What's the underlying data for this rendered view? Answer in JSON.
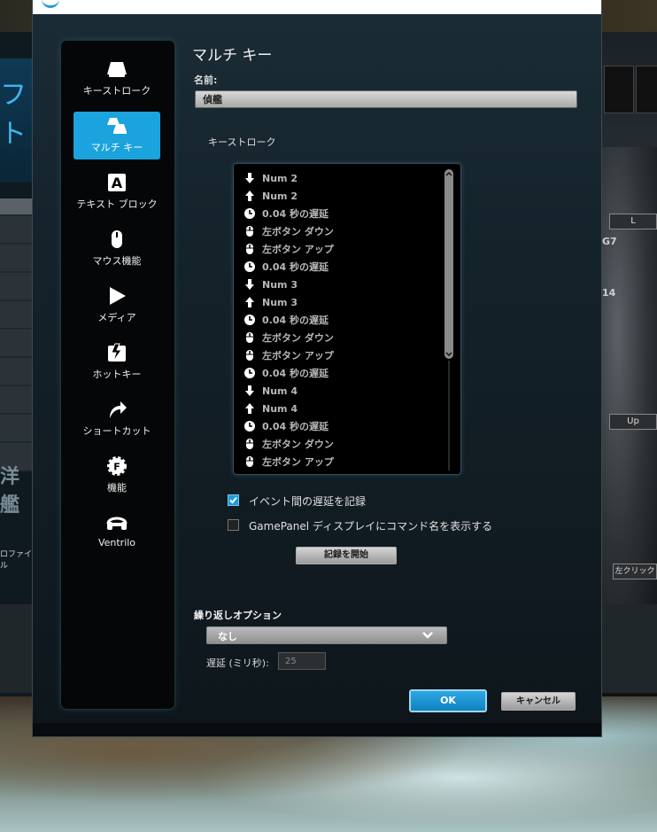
{
  "background": {
    "left_fragment": "フト",
    "left_big_text": "洋艦",
    "left_profile": "ロファイル",
    "right_L": "L",
    "right_G7": "G7",
    "right_14": "14",
    "right_up": "Up",
    "right_left_click": "左クリック"
  },
  "dialog": {
    "heading": "マルチ キー",
    "name_label": "名前:",
    "name_value": "偵艦",
    "keystroke_label": "キーストローク"
  },
  "sidebar": {
    "items": [
      {
        "label": "キーストローク",
        "icon": "keycap-icon"
      },
      {
        "label": "マルチ キー",
        "icon": "multikey-icon"
      },
      {
        "label": "テキスト ブロック",
        "icon": "text-block-icon"
      },
      {
        "label": "マウス機能",
        "icon": "mouse-icon"
      },
      {
        "label": "メディア",
        "icon": "play-icon"
      },
      {
        "label": "ホットキー",
        "icon": "hotkey-icon"
      },
      {
        "label": "ショートカット",
        "icon": "shortcut-arrow-icon"
      },
      {
        "label": "機能",
        "icon": "function-gear-icon"
      },
      {
        "label": "Ventrilo",
        "icon": "headset-icon"
      }
    ],
    "active_index": 1
  },
  "keystrokes": [
    {
      "type": "down",
      "text": "Num 2"
    },
    {
      "type": "up",
      "text": "Num 2"
    },
    {
      "type": "delay",
      "text": "0.04 秒の遅延"
    },
    {
      "type": "mouse",
      "text": "左ボタン ダウン"
    },
    {
      "type": "mouse",
      "text": "左ボタン アップ"
    },
    {
      "type": "delay",
      "text": "0.04 秒の遅延"
    },
    {
      "type": "down",
      "text": "Num 3"
    },
    {
      "type": "up",
      "text": "Num 3"
    },
    {
      "type": "delay",
      "text": "0.04 秒の遅延"
    },
    {
      "type": "mouse",
      "text": "左ボタン ダウン"
    },
    {
      "type": "mouse",
      "text": "左ボタン アップ"
    },
    {
      "type": "delay",
      "text": "0.04 秒の遅延"
    },
    {
      "type": "down",
      "text": "Num 4"
    },
    {
      "type": "up",
      "text": "Num 4"
    },
    {
      "type": "delay",
      "text": "0.04 秒の遅延"
    },
    {
      "type": "mouse",
      "text": "左ボタン ダウン"
    },
    {
      "type": "mouse",
      "text": "左ボタン アップ"
    }
  ],
  "options": {
    "record_delays_label": "イベント間の遅延を記録",
    "record_delays_checked": true,
    "gamepanel_label": "GamePanel ディスプレイにコマンド名を表示する",
    "gamepanel_checked": false,
    "start_record_button": "記録を開始"
  },
  "repeat": {
    "label": "繰り返しオプション",
    "selected": "なし",
    "delay_label": "遅延 (ミリ秒):",
    "delay_value": "25"
  },
  "buttons": {
    "ok": "OK",
    "cancel": "キャンセル"
  },
  "colors": {
    "accent": "#1ba3dd",
    "sidebar_bg": "#050607",
    "dialog_bg": "#14222a"
  }
}
